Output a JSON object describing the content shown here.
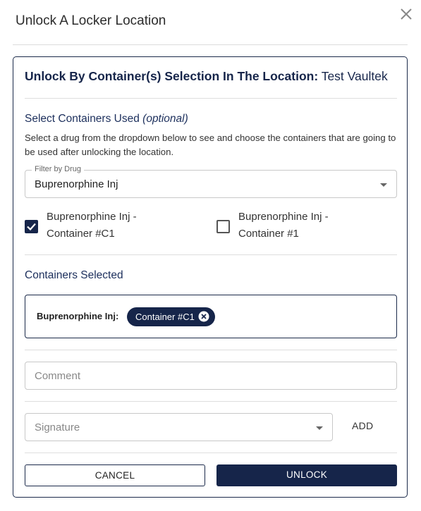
{
  "dialog": {
    "title": "Unlock A Locker Location",
    "close_icon": "close-icon"
  },
  "card": {
    "heading_prefix": "Unlock By Container(s) Selection In The Location:",
    "location_name": "Test Vaultek"
  },
  "containers_section": {
    "label": "Select Containers Used",
    "optional_label": "(optional)",
    "help_text": "Select a drug from the dropdown below to see and choose the containers that are going to be used after unlocking the location."
  },
  "filter": {
    "legend": "Filter by Drug",
    "value": "Buprenorphine Inj",
    "icon": "caret-down-icon"
  },
  "container_options": [
    {
      "line1": "Buprenorphine Inj -",
      "line2": "Container #C1",
      "checked": true
    },
    {
      "line1": "Buprenorphine Inj -",
      "line2": "Container #1",
      "checked": false
    }
  ],
  "selected_section": {
    "label": "Containers Selected",
    "drug_label": "Buprenorphine Inj:",
    "chip_label": "Container #C1",
    "chip_remove_icon": "remove-chip-icon"
  },
  "comment": {
    "placeholder": "Comment"
  },
  "signature": {
    "placeholder": "Signature",
    "add_label": "ADD"
  },
  "actions": {
    "cancel_label": "CANCEL",
    "unlock_label": "UNLOCK"
  },
  "colors": {
    "primary": "#16254a",
    "border": "#c8c8c8",
    "divider": "#dedede"
  }
}
